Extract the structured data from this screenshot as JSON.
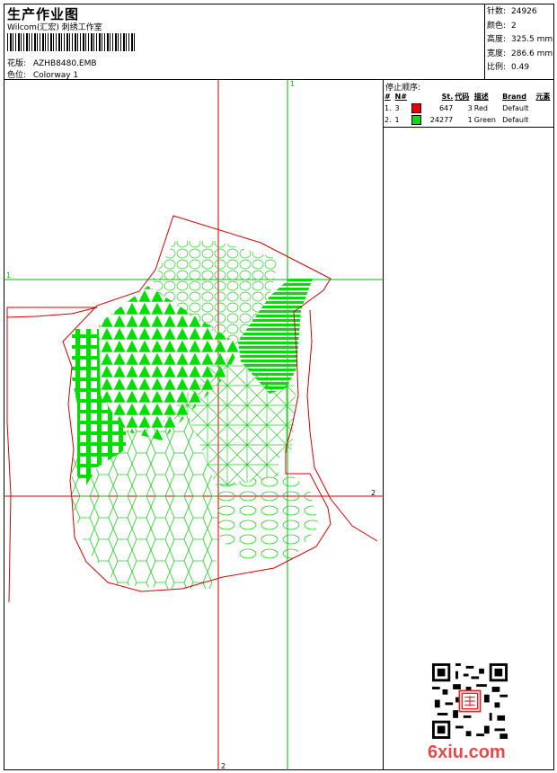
{
  "header": {
    "title": "生产作业图",
    "company": "Wilcom(汇宏) 刺绣工作室",
    "design_label": "花版:",
    "design_value": "AZHB8480.EMB",
    "colorway_label": "色位:",
    "colorway_value": "Colorway 1"
  },
  "stats": {
    "stitches_label": "针数:",
    "stitches_value": "24926",
    "colors_label": "颜色:",
    "colors_value": "2",
    "height_label": "高度:",
    "height_value": "325.5 mm",
    "width_label": "宽度:",
    "width_value": "286.6 mm",
    "scale_label": "比例:",
    "scale_value": "0.49"
  },
  "sequence": {
    "title": "停止顺序:",
    "headers": [
      "#",
      "N#",
      "",
      "St.",
      "代码",
      "描述",
      "Brand",
      "元素"
    ],
    "rows": [
      {
        "index": "1.",
        "needle": "3",
        "color": "#e00000",
        "stitches": "647",
        "code": "3",
        "description": "Red",
        "brand": "Default"
      },
      {
        "index": "2.",
        "needle": "1",
        "color": "#00dd00",
        "stitches": "24277",
        "code": "1",
        "description": "Green",
        "brand": "Default"
      }
    ]
  },
  "guides": {
    "h1": "1",
    "v1": "1",
    "h2": "2",
    "v2": "2"
  },
  "colors": {
    "outline": "#d00000",
    "guide_red": "#cc0000",
    "guide_green": "#00bb00",
    "fill_green": "#00dd00",
    "line_green": "#22cc22"
  },
  "watermark": {
    "site": "6xiu.com",
    "stamp_icon": "seal-stamp-icon",
    "qr_icon": "qr-code-icon"
  }
}
